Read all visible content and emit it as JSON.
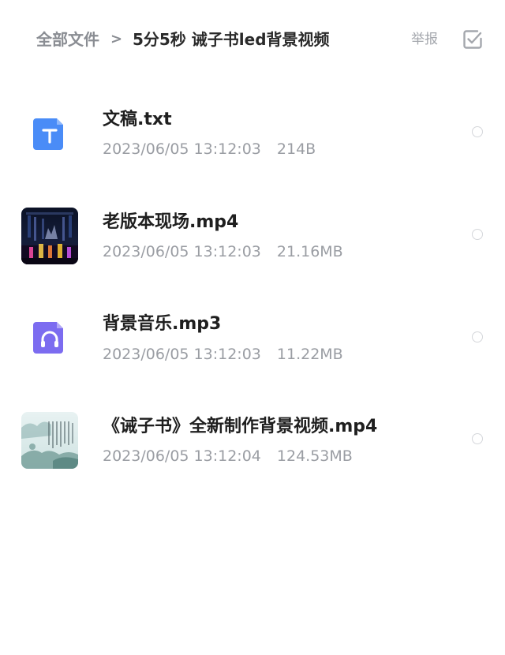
{
  "header": {
    "breadcrumb_root": "全部文件",
    "breadcrumb_separator": ">",
    "breadcrumb_current": "5分5秒 诫子书led背景视频",
    "report_label": "举报",
    "select_all_icon": "checkbox-square-icon"
  },
  "files": [
    {
      "name": "文稿.txt",
      "date": "2023/06/05 13:12:03",
      "size": "214B",
      "icon": "text-file-icon",
      "icon_color": "#4a8cf7"
    },
    {
      "name": "老版本现场.mp4",
      "date": "2023/06/05 13:12:03",
      "size": "21.16MB",
      "icon": "video-thumbnail-stage"
    },
    {
      "name": "背景音乐.mp3",
      "date": "2023/06/05 13:12:03",
      "size": "11.22MB",
      "icon": "audio-file-icon",
      "icon_color": "#7c6cf0"
    },
    {
      "name": "《诫子书》全新制作背景视频.mp4",
      "date": "2023/06/05 13:12:04",
      "size": "124.53MB",
      "icon": "video-thumbnail-landscape"
    }
  ]
}
